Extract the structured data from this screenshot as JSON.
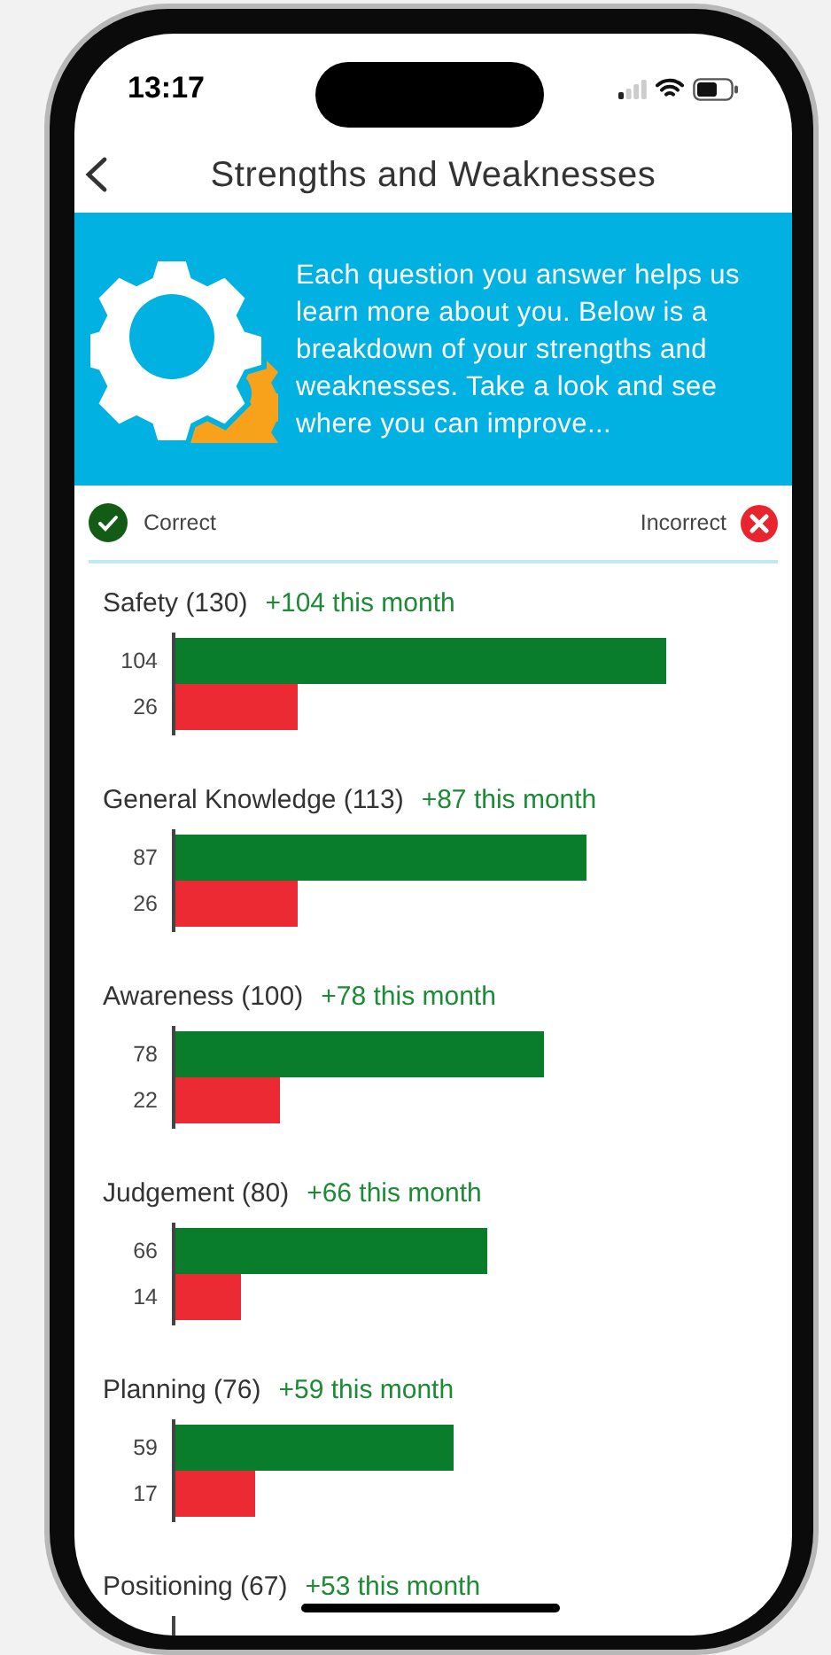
{
  "status_bar": {
    "time": "13:17"
  },
  "header": {
    "title": "Strengths and Weaknesses"
  },
  "banner": {
    "text": "Each question you answer helps us learn more about you. Below is a breakdown of your strengths and weaknesses. Take a look and see where you can improve..."
  },
  "legend": {
    "correct": "Correct",
    "incorrect": "Incorrect"
  },
  "categories": [
    {
      "name": "Safety (130)",
      "change": "+104 this month",
      "correct": {
        "label": "104",
        "level": 0.923
      },
      "incorrect": {
        "label": "26",
        "level": 0.231
      }
    },
    {
      "name": "General Knowledge (113)",
      "change": "+87 this month",
      "correct": {
        "label": "87",
        "level": 0.772
      },
      "incorrect": {
        "label": "26",
        "level": 0.231
      }
    },
    {
      "name": "Awareness (100)",
      "change": "+78 this month",
      "correct": {
        "label": "78",
        "level": 0.692
      },
      "incorrect": {
        "label": "22",
        "level": 0.195
      }
    },
    {
      "name": "Judgement (80)",
      "change": "+66 this month",
      "correct": {
        "label": "66",
        "level": 0.586
      },
      "incorrect": {
        "label": "14",
        "level": 0.124
      }
    },
    {
      "name": "Planning (76)",
      "change": "+59 this month",
      "correct": {
        "label": "59",
        "level": 0.524
      },
      "incorrect": {
        "label": "17",
        "level": 0.151
      }
    },
    {
      "name": "Positioning (67)",
      "change": "+53 this month"
    }
  ]
}
